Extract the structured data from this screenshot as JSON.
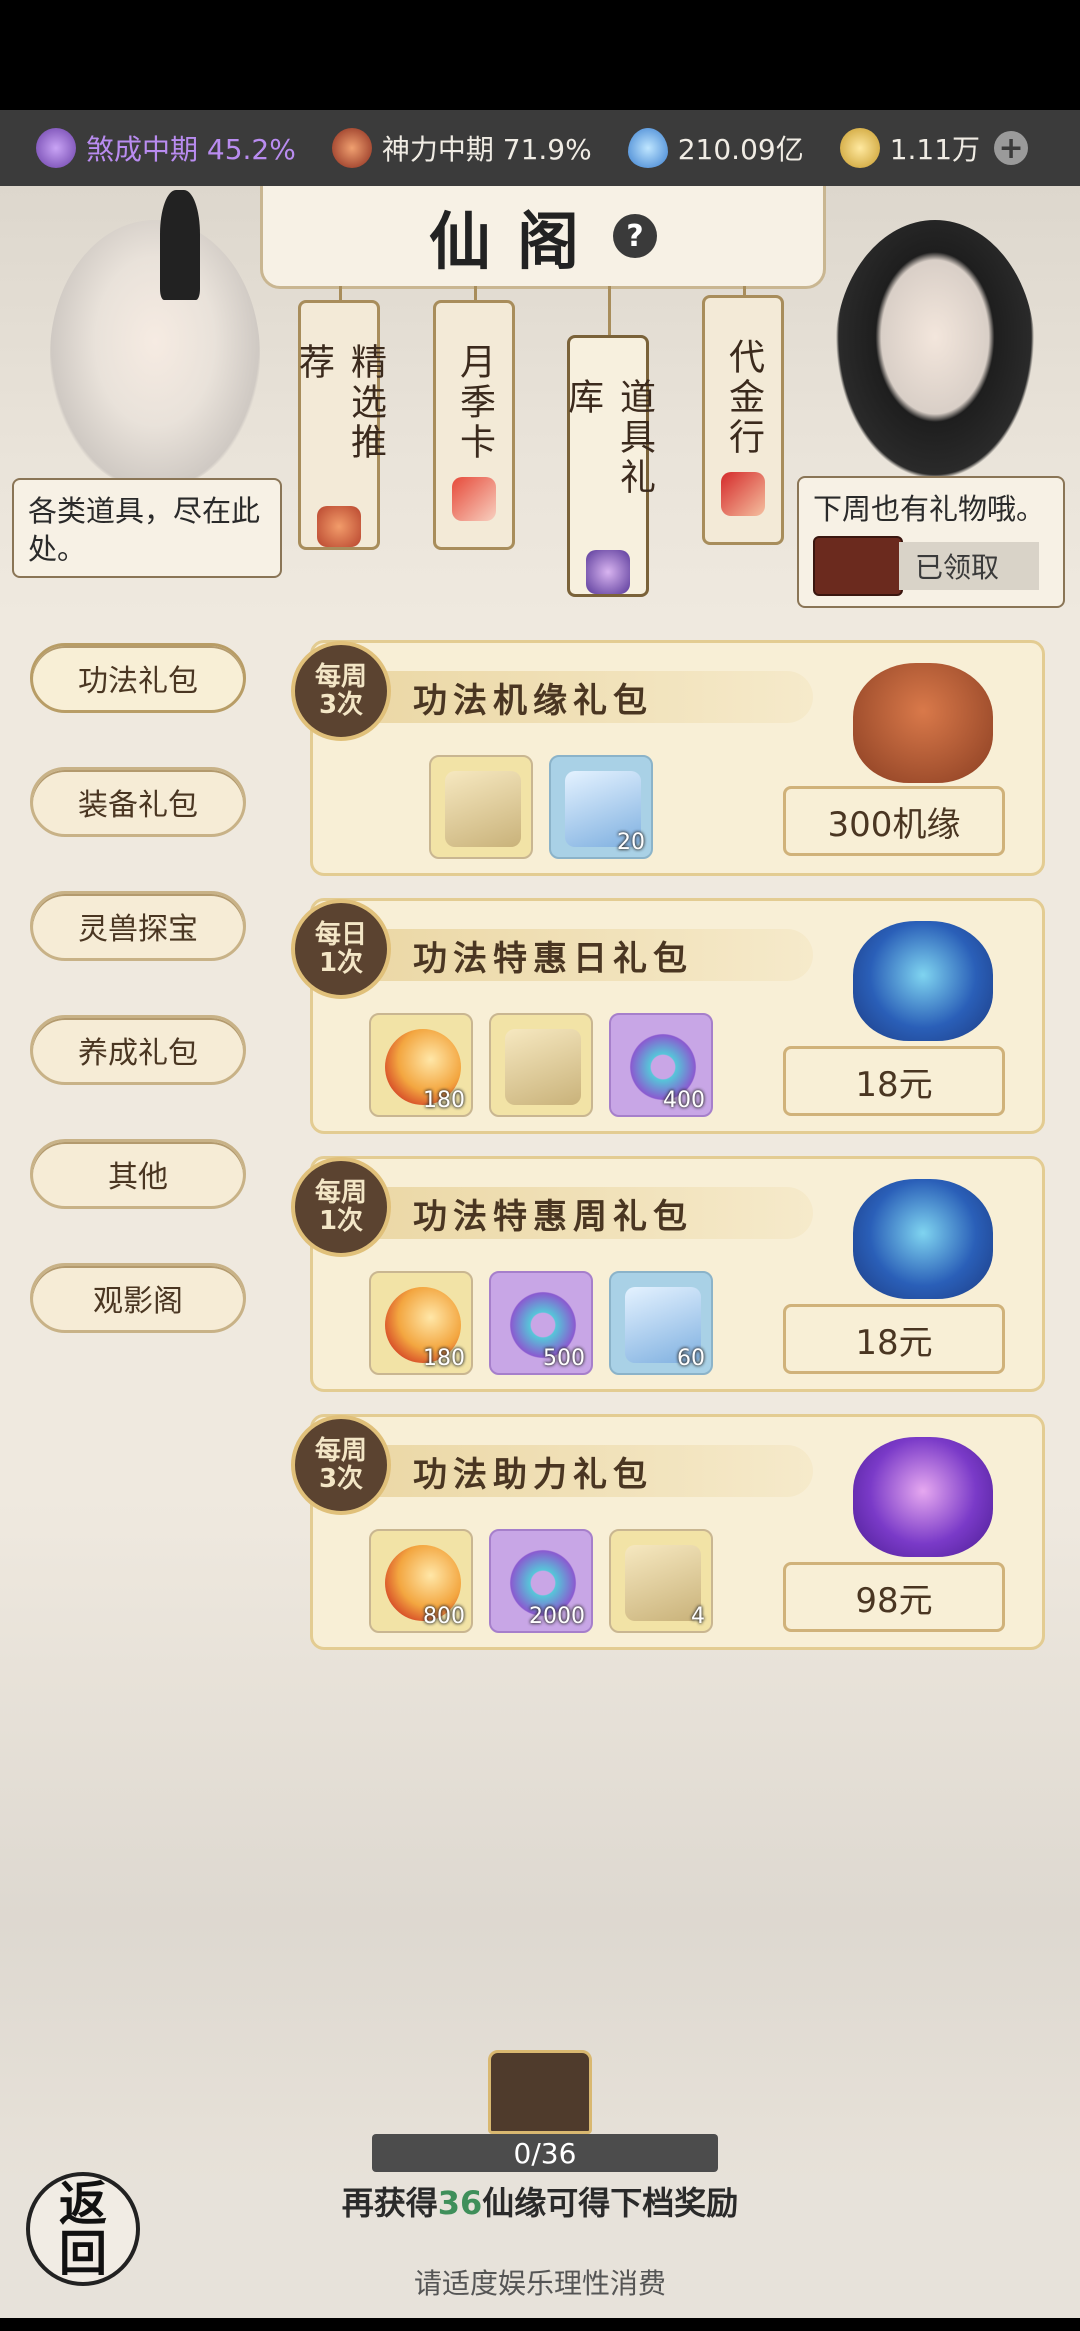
{
  "status_bar": {
    "realm": "煞成中期 45.2%",
    "power": "神力中期 71.9%",
    "spirit_stones": "210.09亿",
    "currency": "1.11万"
  },
  "header": {
    "title": "仙阁",
    "help_icon": "help-icon"
  },
  "tabs": [
    {
      "label": "精选推荐"
    },
    {
      "label": "月季卡"
    },
    {
      "label": "道具礼库"
    },
    {
      "label": "代金行"
    }
  ],
  "left_npc": {
    "speech": "各类道具，尽在此处。"
  },
  "right_npc": {
    "speech": "下周也有礼物哦。",
    "claim_status": "已领取"
  },
  "side_menu": [
    {
      "label": "功法礼包"
    },
    {
      "label": "装备礼包"
    },
    {
      "label": "灵兽探宝"
    },
    {
      "label": "养成礼包"
    },
    {
      "label": "其他"
    },
    {
      "label": "观影阁"
    }
  ],
  "packs": [
    {
      "freq_top": "每周",
      "freq_bottom": "3次",
      "title": "功法机缘礼包",
      "items": [
        {
          "qty": ""
        },
        {
          "qty": "20"
        }
      ],
      "price": "300机缘"
    },
    {
      "freq_top": "每日",
      "freq_bottom": "1次",
      "title": "功法特惠日礼包",
      "items": [
        {
          "qty": "180"
        },
        {
          "qty": ""
        },
        {
          "qty": "400"
        }
      ],
      "price": "18元"
    },
    {
      "freq_top": "每周",
      "freq_bottom": "1次",
      "title": "功法特惠周礼包",
      "items": [
        {
          "qty": "180"
        },
        {
          "qty": "500"
        },
        {
          "qty": "60"
        }
      ],
      "price": "18元"
    },
    {
      "freq_top": "每周",
      "freq_bottom": "3次",
      "title": "功法助力礼包",
      "items": [
        {
          "qty": "800"
        },
        {
          "qty": "2000"
        },
        {
          "qty": "4"
        }
      ],
      "price": "98元"
    }
  ],
  "progress": {
    "text": "0/36",
    "hint_pre": "再获得",
    "hint_num": "36",
    "hint_post": "仙缘可得下档奖励"
  },
  "footer": {
    "notice": "请适度娱乐理性消费",
    "back_label": "返回"
  }
}
